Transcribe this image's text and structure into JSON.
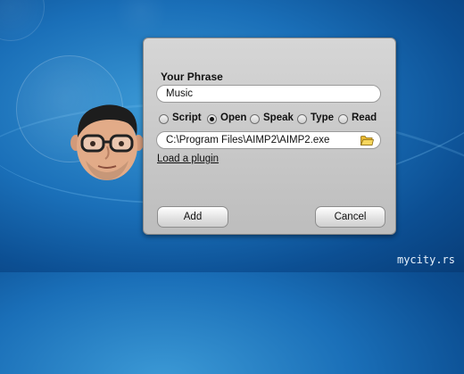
{
  "dialog": {
    "phrase_label": "Your Phrase",
    "phrase_value": "Music",
    "options": [
      {
        "label": "Script",
        "selected": false
      },
      {
        "label": "Open",
        "selected": true
      },
      {
        "label": "Speak",
        "selected": false
      },
      {
        "label": "Type",
        "selected": false
      },
      {
        "label": "Read",
        "selected": false
      }
    ],
    "path_value": "C:\\Program Files\\AIMP2\\AIMP2.exe",
    "browse_icon": "folder-icon",
    "plugin_link": "Load a plugin",
    "add_label": "Add",
    "cancel_label": "Cancel"
  },
  "avatar": {
    "icon": "character-head-avatar"
  },
  "watermark": "mycity.rs"
}
